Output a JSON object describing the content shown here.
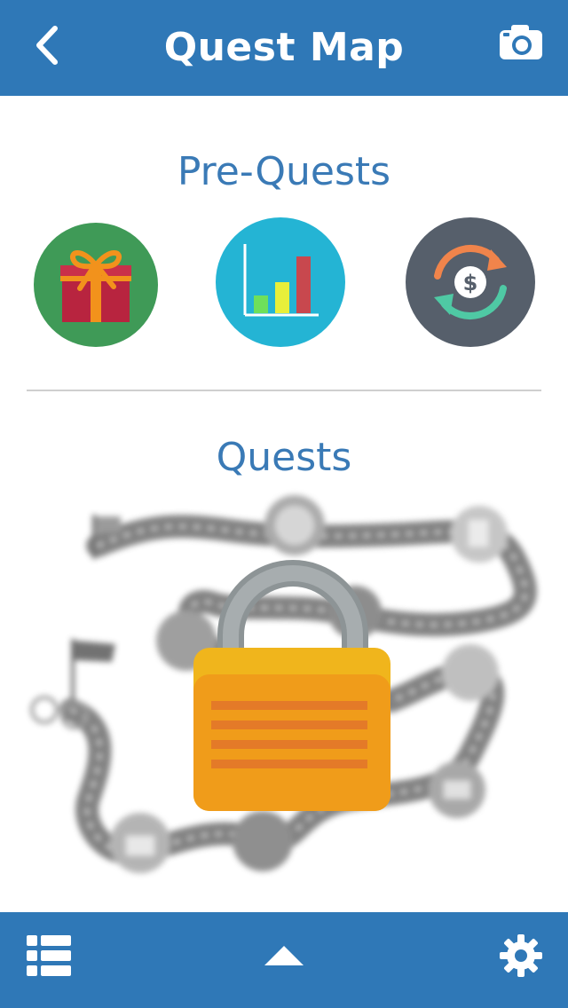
{
  "header": {
    "title": "Quest Map",
    "back_icon": "chevron-left-icon",
    "camera_icon": "camera-icon"
  },
  "prequests": {
    "title": "Pre-Quests",
    "items": [
      {
        "icon": "gift-icon",
        "bg": "#3f9a57"
      },
      {
        "icon": "bar-chart-icon",
        "bg": "#24b4d4"
      },
      {
        "icon": "dollar-exchange-icon",
        "bg": "#565f6b"
      }
    ]
  },
  "quests": {
    "title": "Quests",
    "locked": true,
    "lock_icon": "padlock-icon"
  },
  "footer": {
    "list_icon": "list-icon",
    "up_icon": "triangle-up-icon",
    "settings_icon": "gear-icon"
  },
  "colors": {
    "primary": "#2f78b7",
    "heading": "#3a7ab6"
  }
}
